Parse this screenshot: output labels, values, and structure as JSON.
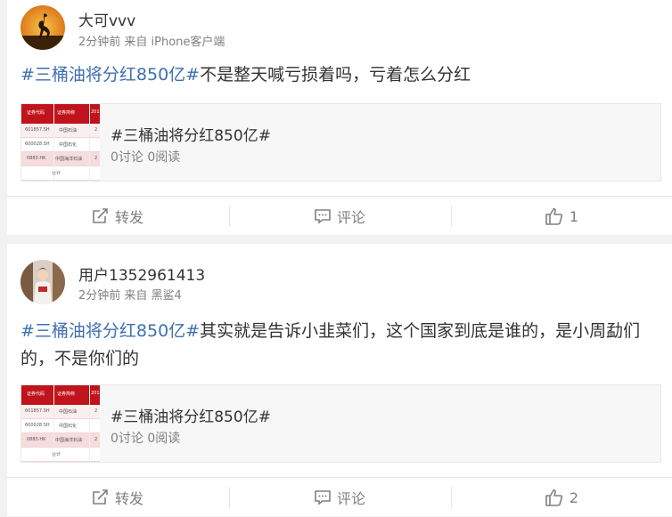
{
  "posts": [
    {
      "username": "大可vvv",
      "meta": "2分钟前 来自 iPhone客户端",
      "hashtag": "#三桶油将分红850亿#",
      "text": "不是整天喊亏损着吗，亏着怎么分红",
      "topic_title": "#三桶油将分红850亿#",
      "topic_stats": "0讨论 0阅读",
      "repost_label": "转发",
      "comment_label": "评论",
      "like_count": "1"
    },
    {
      "username": "用户1352961413",
      "meta": "2分钟前 来自 黑鲨4",
      "hashtag": "#三桶油将分红850亿#",
      "text": "其实就是告诉小韭菜们，这个国家到底是谁的，是小周勐们的，不是你们的",
      "topic_title": "#三桶油将分红850亿#",
      "topic_stats": "0讨论 0阅读",
      "repost_label": "转发",
      "comment_label": "评论",
      "like_count": "2"
    }
  ],
  "thumbnail": {
    "headers": [
      "证券代码",
      "证券简称",
      "201"
    ],
    "rows": [
      [
        "601857.SH",
        "中国石油",
        "2"
      ],
      [
        "600028.SH",
        "中国石化",
        ""
      ],
      [
        "0883.HK",
        "中国海洋石油",
        "2"
      ],
      [
        "",
        "合计",
        ""
      ]
    ]
  },
  "colors": {
    "hashtag": "#3f6fb0",
    "thumb_header": "#c0131b"
  }
}
